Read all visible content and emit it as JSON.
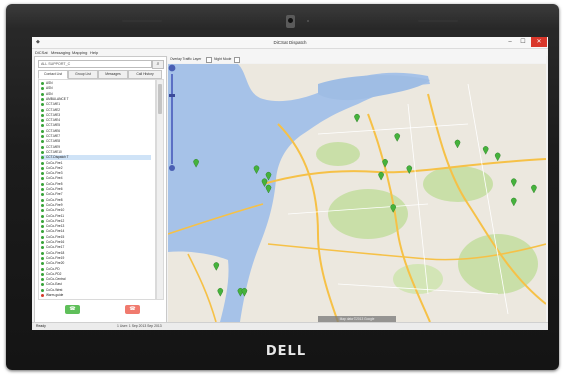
{
  "device": {
    "brand": "DELL"
  },
  "window": {
    "title": "DiCSat Dispatch",
    "controls": {
      "minimize": "–",
      "maximize": "☐",
      "close": "✕"
    }
  },
  "menu": [
    "DiCSat",
    "Messaging",
    "Mapping",
    "Help"
  ],
  "left_panel": {
    "search_value": "ALL SUPPORT_C",
    "tabs": [
      "Contact List",
      "Group List",
      "Messages",
      "Call History"
    ],
    "talkgroups": [
      "ASN",
      "ASN",
      "ASN",
      "AMBULANCE T",
      "CCT-ME1",
      "CCT-ME2",
      "CCT-ME3",
      "CCT-ME4",
      "CCT-ME5",
      "CCT-ME6",
      "CCT-ME7",
      "CCT-ME8",
      "CCT-ME9",
      "CCT-ME10",
      "CCT-Dispatch T",
      "CoCo-Fire1",
      "CoCo-Fire2",
      "CoCo-Fire3",
      "CoCo-Fire4",
      "CoCo-Fire5",
      "CoCo-Fire6",
      "CoCo-Fire7",
      "CoCo-Fire8",
      "CoCo-Fire9",
      "CoCo-Fire10",
      "CoCo-Fire11",
      "CoCo-Fire12",
      "CoCo-Fire13",
      "CoCo-Fire14",
      "CoCo-Fire15",
      "CoCo-Fire16",
      "CoCo-Fire17",
      "CoCo-Fire18",
      "CoCo-Fire19",
      "CoCo-Fire20",
      "CoCo-PD",
      "CoCo-PD2",
      "CoCo-Central",
      "CoCo-East",
      "CoCo-West",
      "Warm-guide"
    ],
    "call_button": "☎",
    "hangup_button": "☎"
  },
  "map_toolbar": {
    "traffic_label": "Overlay Traffic Layer",
    "night_label": "Night Mode"
  },
  "map": {
    "copyright": "Map data ©2013 Google"
  },
  "status": {
    "left": "Ready",
    "right": "1 User: 1 Sep 2013 Sep 2013"
  },
  "colors": {
    "water": "#a6c2e8",
    "land": "#ece8df",
    "park": "#c9dfa8",
    "highway": "#f6c147",
    "marker": "#45b23c",
    "close": "#d9372b"
  },
  "markers": [
    {
      "lat": 37.93,
      "lon": -122.05
    },
    {
      "lat": 37.85,
      "lon": -122.3
    },
    {
      "lat": 37.84,
      "lon": -122.27
    },
    {
      "lat": 37.83,
      "lon": -122.28
    },
    {
      "lat": 37.82,
      "lon": -122.27
    },
    {
      "lat": 37.86,
      "lon": -122.45
    },
    {
      "lat": 37.9,
      "lon": -121.95
    },
    {
      "lat": 37.89,
      "lon": -121.8
    },
    {
      "lat": 37.88,
      "lon": -121.73
    },
    {
      "lat": 37.87,
      "lon": -121.7
    },
    {
      "lat": 37.86,
      "lon": -121.98
    },
    {
      "lat": 37.85,
      "lon": -121.92
    },
    {
      "lat": 37.84,
      "lon": -121.99
    },
    {
      "lat": 37.83,
      "lon": -121.66
    },
    {
      "lat": 37.82,
      "lon": -121.61
    },
    {
      "lat": 37.8,
      "lon": -121.66
    },
    {
      "lat": 37.79,
      "lon": -121.96
    },
    {
      "lat": 37.7,
      "lon": -122.4
    },
    {
      "lat": 37.66,
      "lon": -122.39
    },
    {
      "lat": 37.66,
      "lon": -122.34
    },
    {
      "lat": 37.66,
      "lon": -122.33
    }
  ]
}
